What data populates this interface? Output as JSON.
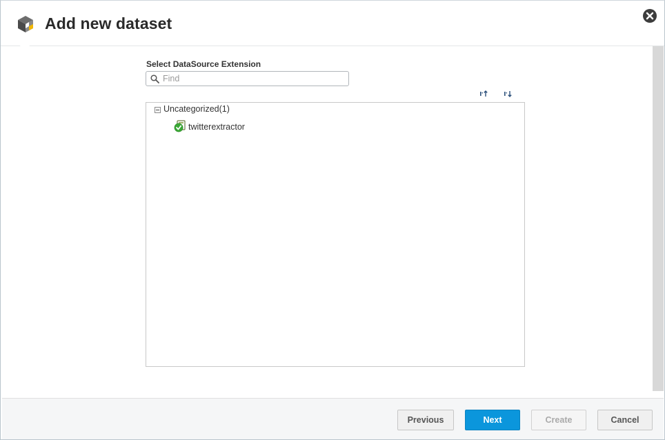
{
  "dialog": {
    "title": "Add new dataset",
    "logo_icon": "cube-logo-icon",
    "close_icon": "close-icon"
  },
  "datasource": {
    "label": "Select DataSource Extension",
    "search_placeholder": "Find",
    "search_value": "",
    "sort_ascending_icon": "sort-ascending-icon",
    "sort_descending_icon": "sort-descending-icon"
  },
  "tree": {
    "categories": [
      {
        "label": "Uncategorized(1)",
        "expanded": true,
        "items": [
          {
            "label": "twitterextractor",
            "icon": "extension-check-icon"
          }
        ]
      }
    ]
  },
  "footer": {
    "previous_label": "Previous",
    "next_label": "Next",
    "create_label": "Create",
    "cancel_label": "Cancel"
  },
  "colors": {
    "primary": "#0b96dc",
    "success": "#3aa935",
    "accent": "#f2b705"
  }
}
